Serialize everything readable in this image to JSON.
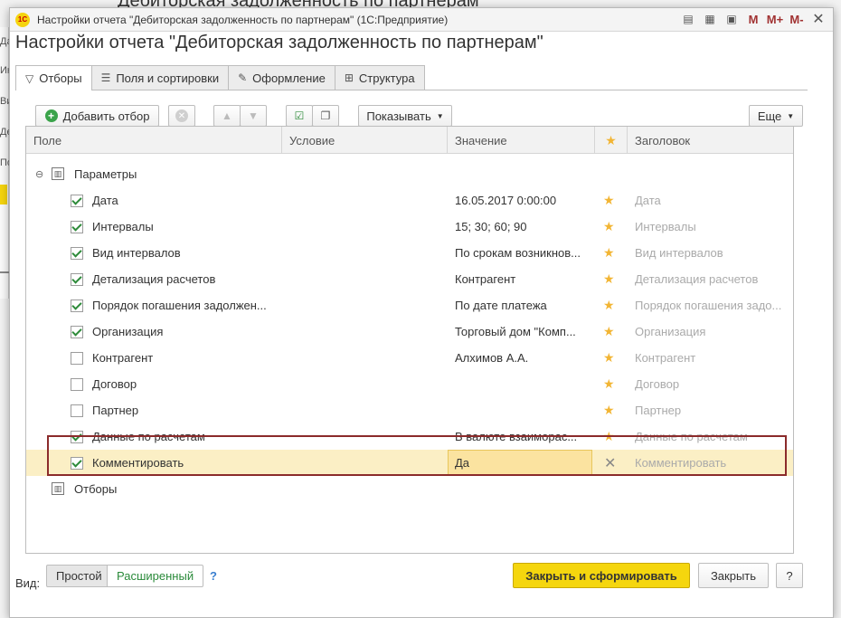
{
  "background": {
    "title": "Дебиторская задолженность по партнерам",
    "letters": [
      "Да",
      "Ин",
      "Ви",
      "Де",
      "По"
    ]
  },
  "window": {
    "title": "Настройки отчета \"Дебиторская задолженность по партнерам\"  (1С:Предприятие)",
    "logo_text": "1С"
  },
  "form": {
    "title": "Настройки отчета \"Дебиторская задолженность по партнерам\""
  },
  "tabs": [
    {
      "label": "Отборы",
      "icon": "filter-icon",
      "active": true
    },
    {
      "label": "Поля и сортировки",
      "icon": "fields-icon",
      "active": false
    },
    {
      "label": "Оформление",
      "icon": "brush-icon",
      "active": false
    },
    {
      "label": "Структура",
      "icon": "structure-icon",
      "active": false
    }
  ],
  "toolbar": {
    "add_filter": "Добавить отбор",
    "show": "Показывать",
    "more": "Еще"
  },
  "grid": {
    "headers": {
      "field": "Поле",
      "condition": "Условие",
      "value": "Значение",
      "title": "Заголовок"
    },
    "group_params": "Параметры",
    "group_filters": "Отборы",
    "rows": [
      {
        "checked": true,
        "field": "Дата",
        "value": "16.05.2017 0:00:00",
        "title": "Дата"
      },
      {
        "checked": true,
        "field": "Интервалы",
        "value": "15; 30; 60; 90",
        "title": "Интервалы"
      },
      {
        "checked": true,
        "field": "Вид интервалов",
        "value": "По срокам возникнов...",
        "title": "Вид интервалов"
      },
      {
        "checked": true,
        "field": "Детализация расчетов",
        "value": "Контрагент",
        "title": "Детализация расчетов"
      },
      {
        "checked": true,
        "field": "Порядок погашения задолжен...",
        "value": "По дате платежа",
        "title": "Порядок погашения задо..."
      },
      {
        "checked": true,
        "field": "Организация",
        "value": "Торговый дом \"Комп...",
        "title": "Организация"
      },
      {
        "checked": false,
        "field": "Контрагент",
        "value": "Алхимов А.А.",
        "title": "Контрагент"
      },
      {
        "checked": false,
        "field": "Договор",
        "value": "",
        "title": "Договор"
      },
      {
        "checked": false,
        "field": "Партнер",
        "value": "",
        "title": "Партнер"
      },
      {
        "checked": true,
        "field": "Данные по расчетам",
        "value": "В валюте взаиморас...",
        "title": "Данные по расчетам"
      },
      {
        "checked": true,
        "field": "Комментировать",
        "value": "Да",
        "title": "Комментировать",
        "selected": true
      }
    ]
  },
  "footer": {
    "view_label": "Вид:",
    "simple": "Простой",
    "extended": "Расширенный",
    "help": "?",
    "generate": "Закрыть и сформировать",
    "close": "Закрыть",
    "question": "?"
  },
  "colors": {
    "primary_button": "#f5d60e",
    "selected_row": "#fbefc5",
    "star": "#f2b534",
    "highlight_frame": "#8b2b2b"
  }
}
